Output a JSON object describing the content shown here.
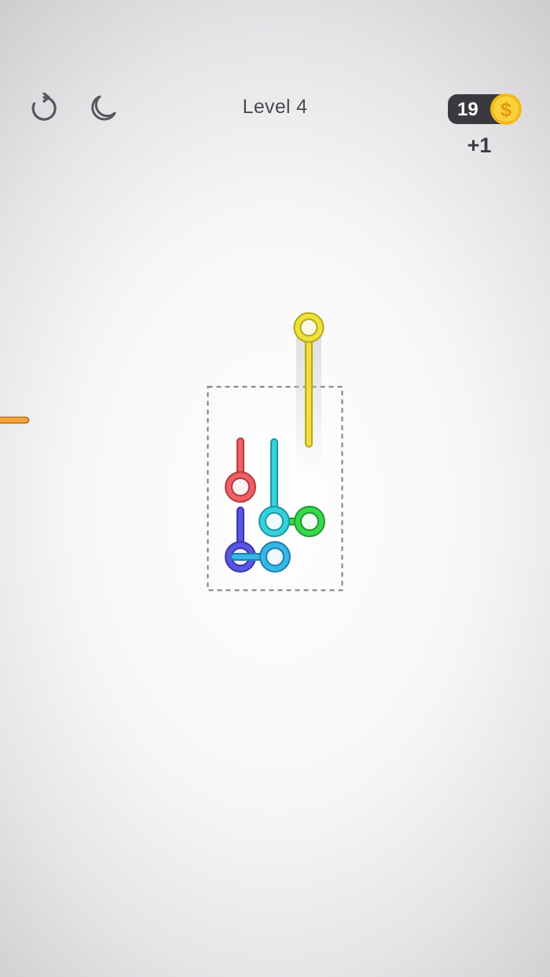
{
  "header": {
    "level_label": "Level 4",
    "coins": "19",
    "coin_gain": "+1"
  },
  "icons": {
    "restart": "restart-icon",
    "night_mode": "moon-icon",
    "coin": "dollar-coin-icon"
  },
  "colors": {
    "yellow_pin": "#efe13b",
    "red_pin": "#ef5f63",
    "cyan_pin": "#35d2dd",
    "green_pin": "#37d84a",
    "blue_pin": "#5b55e5",
    "orange_rod": "#f3a23a",
    "coin": "#f6c320"
  },
  "pins": [
    {
      "name": "yellow",
      "color": "#efe13b"
    },
    {
      "name": "red",
      "color": "#ef5f63"
    },
    {
      "name": "cyan",
      "color": "#35d2dd"
    },
    {
      "name": "green",
      "color": "#37d84a"
    },
    {
      "name": "blue",
      "color": "#5b55e5"
    },
    {
      "name": "light-blue",
      "color": "#35b8e6"
    }
  ]
}
